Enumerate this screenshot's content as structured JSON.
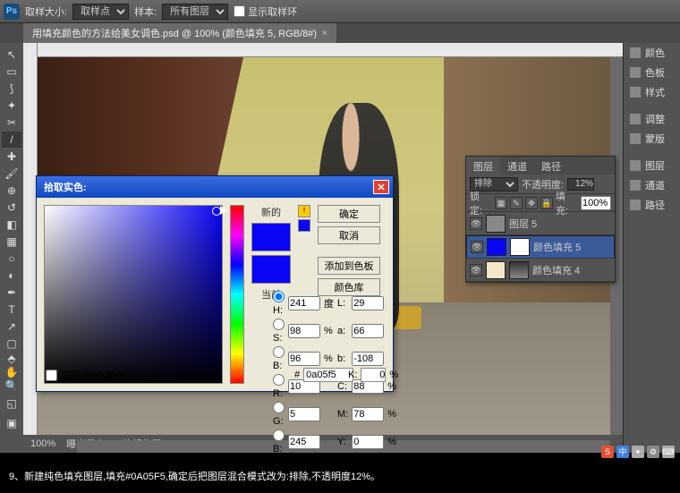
{
  "topbar": {
    "sample_size_label": "取样大小:",
    "sample_size_value": "取样点",
    "sample_label": "样本:",
    "sample_value": "所有图层",
    "show_ring": "显示取样环"
  },
  "doctab": {
    "title": "用填充颜色的方法给美女调色.psd @ 100% (颜色填充 5, RGB/8#)"
  },
  "status": {
    "zoom": "100%",
    "exposure": "曝光只在 32 位起作用"
  },
  "rpanel": {
    "items": [
      "颜色",
      "色板",
      "样式",
      "调整",
      "蒙版",
      "图层",
      "通道",
      "路径"
    ]
  },
  "dialog": {
    "title": "拾取实色:",
    "new_label": "新的",
    "current_label": "当前",
    "ok": "确定",
    "cancel": "取消",
    "add": "添加到色板",
    "lib": "颜色库",
    "webonly": "只有 Web 颜色",
    "H": {
      "v": "241",
      "u": "度"
    },
    "S": {
      "v": "98",
      "u": "%"
    },
    "B": {
      "v": "96",
      "u": "%"
    },
    "R": {
      "v": "10"
    },
    "G": {
      "v": "5"
    },
    "Bb": {
      "v": "245"
    },
    "L": {
      "v": "29"
    },
    "a": {
      "v": "66"
    },
    "b": {
      "v": "-108"
    },
    "C": {
      "v": "88",
      "u": "%"
    },
    "M": {
      "v": "78",
      "u": "%"
    },
    "Y": {
      "v": "0",
      "u": "%"
    },
    "K": {
      "v": "0",
      "u": "%"
    },
    "hex": "0a05f5"
  },
  "layers": {
    "tabs": [
      "图层",
      "通道",
      "路径"
    ],
    "blend": "排除",
    "opacity_label": "不透明度:",
    "opacity": "12%",
    "lock_label": "锁定:",
    "fill_label": "填充:",
    "fill": "100%",
    "rows": [
      {
        "name": "图层 5"
      },
      {
        "name": "颜色填充 5"
      },
      {
        "name": "颜色填充 4"
      }
    ]
  },
  "caption": "9、新建纯色填充图层,填充#0A05F5,确定后把图层混合模式改为:排除,不透明度12%。"
}
